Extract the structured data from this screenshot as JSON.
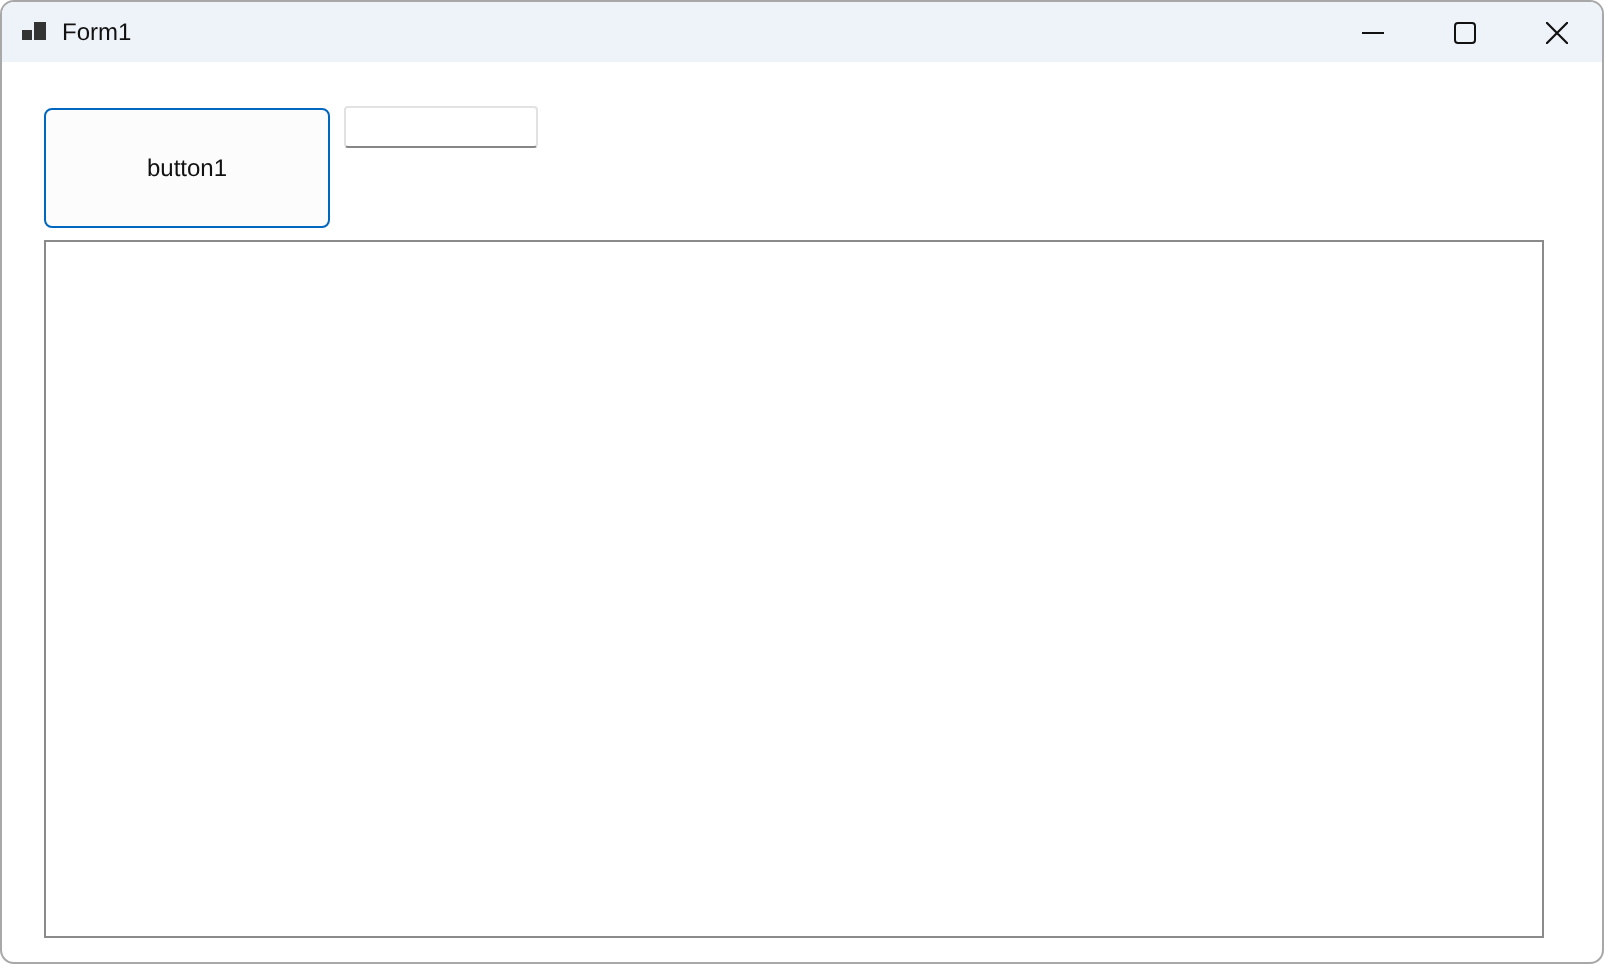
{
  "window": {
    "title": "Form1"
  },
  "button": {
    "label": "button1"
  }
}
